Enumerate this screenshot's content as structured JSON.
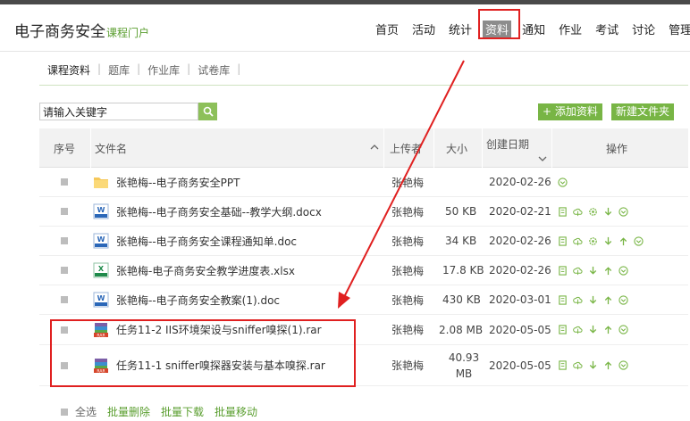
{
  "header": {
    "title": "电子商务安全",
    "subtitle": "课程门户",
    "nav": [
      "首页",
      "活动",
      "统计",
      "资料",
      "通知",
      "作业",
      "考试",
      "讨论",
      "管理"
    ],
    "active_nav": "资料"
  },
  "tabs": [
    "课程资料",
    "题库",
    "作业库",
    "试卷库"
  ],
  "search": {
    "value": "请输入关键字"
  },
  "buttons": {
    "add": "+ 添加资料",
    "new_folder": "新建文件夹"
  },
  "table": {
    "headers": {
      "index": "序号",
      "name": "文件名",
      "uploader": "上传者",
      "size": "大小",
      "date": "创建日期",
      "ops": "操作"
    },
    "rows": [
      {
        "type": "folder",
        "name": "张艳梅--电子商务安全PPT",
        "uploader": "张艳梅",
        "size": "",
        "date": "2020-02-26"
      },
      {
        "type": "word",
        "name": "张艳梅--电子商务安全基础--教学大纲.docx",
        "uploader": "张艳梅",
        "size": "50 KB",
        "date": "2020-02-21"
      },
      {
        "type": "word",
        "name": "张艳梅--电子商务安全课程通知单.doc",
        "uploader": "张艳梅",
        "size": "34 KB",
        "date": "2020-02-26"
      },
      {
        "type": "excel",
        "name": "张艳梅-电子商务安全教学进度表.xlsx",
        "uploader": "张艳梅",
        "size": "17.8 KB",
        "date": "2020-02-26"
      },
      {
        "type": "word",
        "name": "张艳梅--电子商务安全教案(1).doc",
        "uploader": "张艳梅",
        "size": "430 KB",
        "date": "2020-03-01"
      },
      {
        "type": "rar",
        "name": "任务11-2 IIS环境架设与sniffer嗅探(1).rar",
        "uploader": "张艳梅",
        "size": "2.08 MB",
        "date": "2020-05-05"
      },
      {
        "type": "rar",
        "name": "任务11-1 sniffer嗅探器安装与基本嗅探.rar",
        "uploader": "张艳梅",
        "size": "40.93 MB",
        "date": "2020-05-05"
      }
    ]
  },
  "footer": {
    "select_all": "全选",
    "batch_delete": "批量删除",
    "batch_download": "批量下载",
    "batch_move": "批量移动"
  },
  "icons": {
    "word_label": "Word",
    "excel_label": "X",
    "rar_label": "RAR"
  },
  "colors": {
    "accent": "#78b545",
    "highlight": "#e02020",
    "folder": "#f6c85a",
    "word": "#2b67b8",
    "excel": "#1e8a4a",
    "rar": "#d6452a"
  }
}
